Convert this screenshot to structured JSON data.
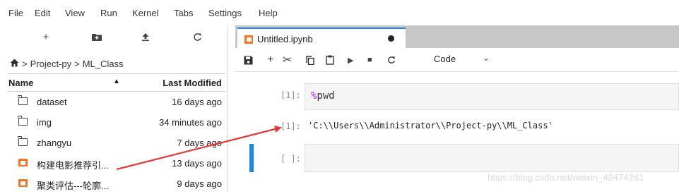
{
  "menu": [
    "File",
    "Edit",
    "View",
    "Run",
    "Kernel",
    "Tabs",
    "Settings",
    "Help"
  ],
  "file_browser": {
    "toolbar_icons": [
      "new-launcher-icon",
      "new-folder-icon",
      "upload-icon",
      "refresh-icon"
    ],
    "breadcrumb": {
      "separator": ">",
      "items": [
        "Project-py",
        "ML_Class"
      ]
    },
    "columns": {
      "name": "Name",
      "modified": "Last Modified"
    },
    "files": [
      {
        "name": "dataset",
        "modified": "16 days ago",
        "kind": "folder"
      },
      {
        "name": "img",
        "modified": "34 minutes ago",
        "kind": "folder"
      },
      {
        "name": "zhangyu",
        "modified": "7 days ago",
        "kind": "folder"
      },
      {
        "name": "构建电影推荐引...",
        "modified": "13 days ago",
        "kind": "notebook"
      },
      {
        "name": "聚类评估---轮廓...",
        "modified": "9 days ago",
        "kind": "notebook"
      }
    ]
  },
  "notebook": {
    "tab_title": "Untitled.ipynb",
    "cell_type": "Code",
    "toolbar_icons": [
      "save-icon",
      "add-cell-icon",
      "cut-icon",
      "copy-icon",
      "paste-icon",
      "run-icon",
      "stop-icon",
      "restart-icon"
    ],
    "cells": [
      {
        "prompt": "[1]:",
        "magic": "%",
        "code": "pwd"
      },
      {
        "output_prompt": "[1]:",
        "output": "'C:\\\\Users\\\\Administrator\\\\Project-py\\\\ML_Class'"
      },
      {
        "prompt": "[ ]:"
      }
    ]
  },
  "watermark": "https://blog.csdn.net/weixin_42474261",
  "colors": {
    "accent": "#1e88e5",
    "notebook_icon": "#f37626",
    "arrow": "#e53935",
    "tabbar": "#c7c7c7"
  }
}
